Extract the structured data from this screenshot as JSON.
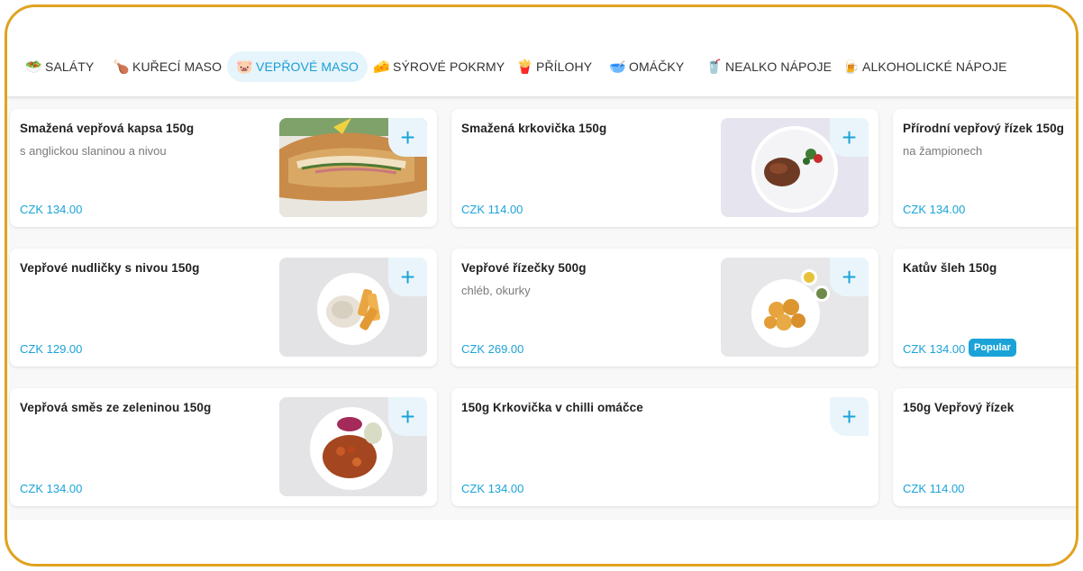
{
  "categories": [
    {
      "icon": "🥗",
      "label": "SALÁTY",
      "active": false
    },
    {
      "icon": "🍗",
      "label": "KUŘECÍ MASO",
      "active": false
    },
    {
      "icon": "🐷",
      "label": "VEPŘOVÉ MASO",
      "active": true
    },
    {
      "icon": "🧀",
      "label": "SÝROVÉ POKRMY",
      "active": false
    },
    {
      "icon": "🍟",
      "label": "PŘÍLOHY",
      "active": false
    },
    {
      "icon": "🥣",
      "label": "OMÁČKY",
      "active": false
    },
    {
      "icon": "🥤",
      "label": "NEALKO NÁPOJE",
      "active": false
    },
    {
      "icon": "🍺",
      "label": "ALKOHOLICKÉ NÁPOJE",
      "active": false
    }
  ],
  "add_label": "+",
  "products": [
    {
      "name": "Smažená vepřová kapsa 150g",
      "desc": "s anglickou slaninou a nivou",
      "price": "CZK 134.00"
    },
    {
      "name": "Smažená krkovička 150g",
      "desc": "",
      "price": "CZK 114.00"
    },
    {
      "name": "Přírodní vepřový řízek 150g",
      "desc": "na žampionech",
      "price": "CZK 134.00"
    },
    {
      "name": "Vepřové nudličky s nivou 150g",
      "desc": "",
      "price": "CZK 129.00"
    },
    {
      "name": "Vepřové řízečky 500g",
      "desc": "chléb, okurky",
      "price": "CZK 269.00"
    },
    {
      "name": "Katův šleh 150g",
      "desc": "",
      "price": "CZK 134.00",
      "badge": "Popular"
    },
    {
      "name": "Vepřová směs ze zeleninou 150g",
      "desc": "",
      "price": "CZK 134.00"
    },
    {
      "name": "150g Krkovička v chilli omáčce",
      "desc": "",
      "price": "CZK 134.00"
    },
    {
      "name": "150g Vepřový řízek",
      "desc": "",
      "price": "CZK 114.00"
    }
  ]
}
